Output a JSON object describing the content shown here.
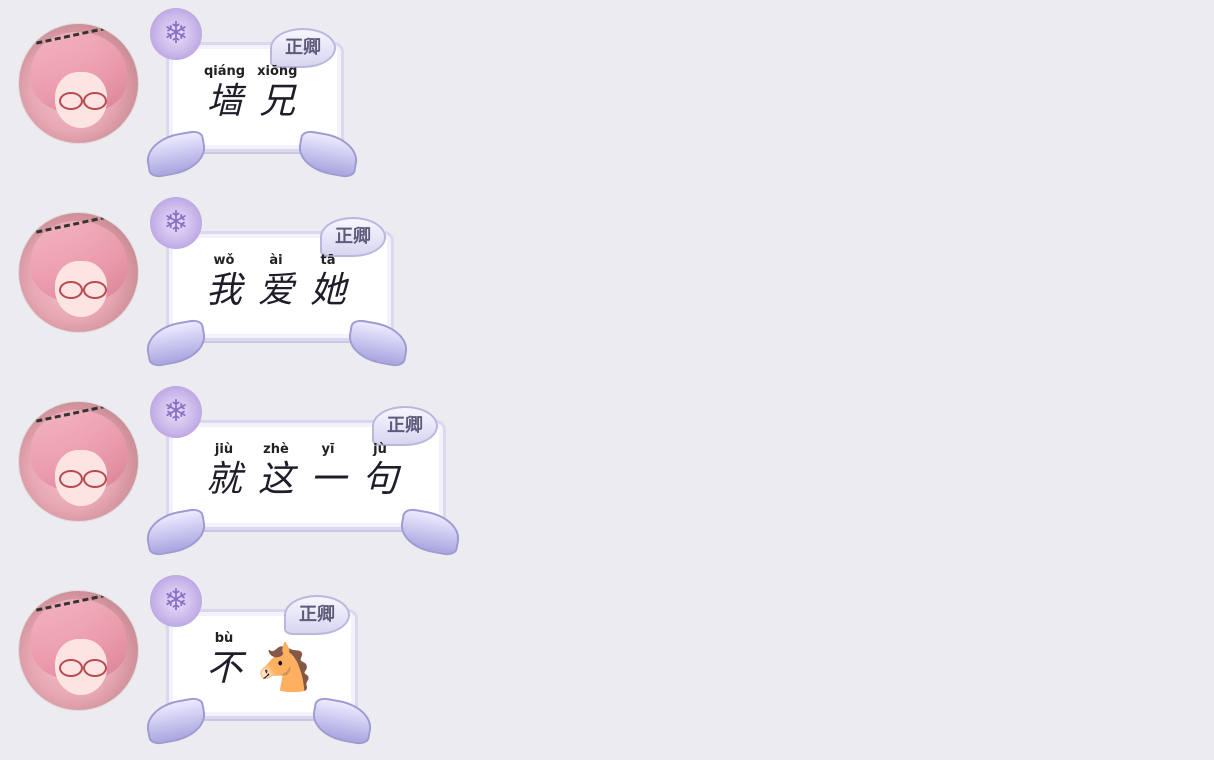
{
  "messages": [
    {
      "tag": "正卿",
      "words": [
        {
          "pinyin": "qiáng",
          "hanzi": "墙"
        },
        {
          "pinyin": "xiōng",
          "hanzi": "兄"
        }
      ]
    },
    {
      "tag": "正卿",
      "words": [
        {
          "pinyin": "wǒ",
          "hanzi": "我"
        },
        {
          "pinyin": "ài",
          "hanzi": "爱"
        },
        {
          "pinyin": "tā",
          "hanzi": "她"
        }
      ]
    },
    {
      "tag": "正卿",
      "words": [
        {
          "pinyin": "jiù",
          "hanzi": "就"
        },
        {
          "pinyin": "zhè",
          "hanzi": "这"
        },
        {
          "pinyin": "yī",
          "hanzi": "一"
        },
        {
          "pinyin": "jù",
          "hanzi": "句"
        }
      ]
    },
    {
      "tag": "正卿",
      "words": [
        {
          "pinyin": "bù",
          "hanzi": "不"
        }
      ],
      "emoji": "🐴"
    }
  ]
}
